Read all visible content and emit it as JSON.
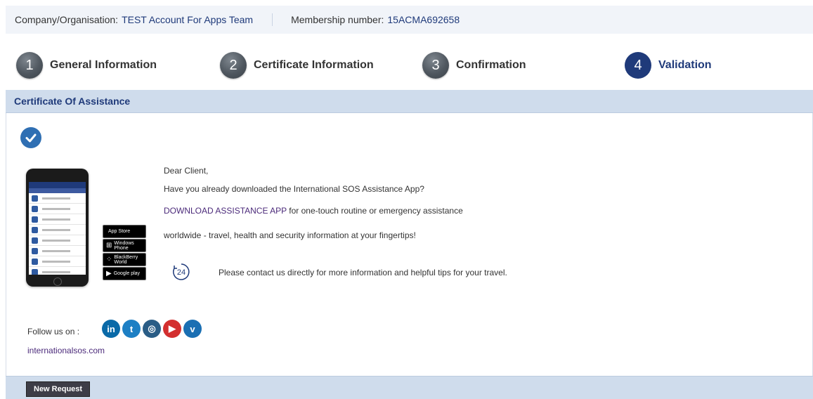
{
  "topbar": {
    "company_label": "Company/Organisation:",
    "company_value": "TEST Account For Apps Team",
    "membership_label": "Membership number:",
    "membership_value": "15ACMA692658"
  },
  "steps": [
    {
      "number": "1",
      "label": "General Information"
    },
    {
      "number": "2",
      "label": "Certificate Information"
    },
    {
      "number": "3",
      "label": "Confirmation"
    },
    {
      "number": "4",
      "label": "Validation"
    }
  ],
  "active_step": 4,
  "section": {
    "title": "Certificate Of Assistance"
  },
  "message": {
    "greeting": "Dear Client,",
    "question": "Have you already downloaded the International SOS Assistance App?",
    "download_link": "DOWNLOAD ASSISTANCE APP",
    "download_text": " for one-touch routine or emergency assistance",
    "line3": "worldwide - travel, health and security information at your fingertips!",
    "contact": "Please contact us directly for more information and helpful tips for your travel."
  },
  "badges": [
    {
      "icon": "apple-icon",
      "text": "App Store"
    },
    {
      "icon": "windows-icon",
      "text": "Windows Phone"
    },
    {
      "icon": "blackberry-icon",
      "text": "BlackBerry World"
    },
    {
      "icon": "google-play-icon",
      "text": "Google play"
    }
  ],
  "follow": {
    "label": "Follow us on :",
    "website": "internationalsos.com",
    "networks": [
      {
        "icon": "linkedin-icon",
        "glyph": "in",
        "color": "#0a6aa8"
      },
      {
        "icon": "twitter-icon",
        "glyph": "t",
        "color": "#1d7fc4"
      },
      {
        "icon": "instagram-icon",
        "glyph": "◎",
        "color": "#2a5d86"
      },
      {
        "icon": "youtube-icon",
        "glyph": "▶",
        "color": "#d32f2f"
      },
      {
        "icon": "vimeo-icon",
        "glyph": "v",
        "color": "#1a6fb3"
      }
    ]
  },
  "footer": {
    "new_request_label": "New Request"
  },
  "colors": {
    "accent": "#1f3a7a",
    "header_band": "#cfdcec",
    "link": "#4b2a7a"
  }
}
